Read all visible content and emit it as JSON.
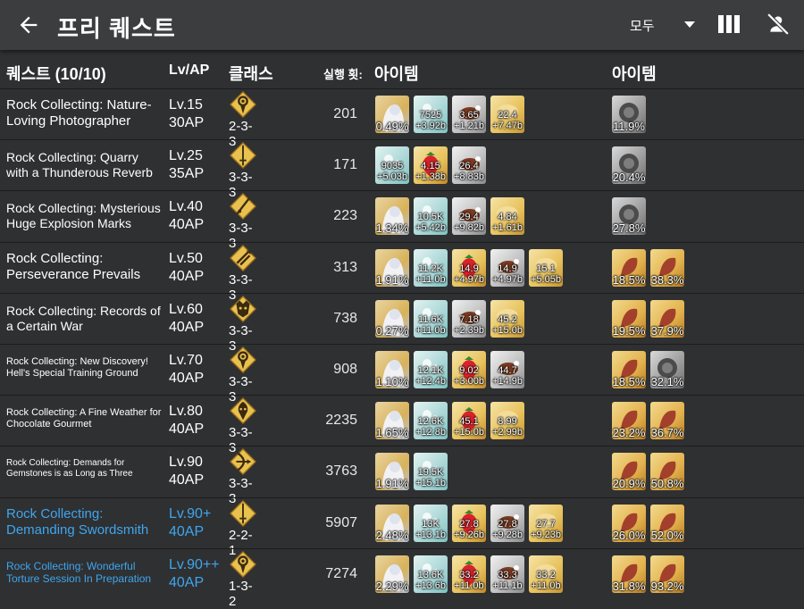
{
  "header": {
    "title": "프리 퀘스트",
    "filter": "모두"
  },
  "table_header": {
    "quests": "퀘스트 (10/10)",
    "lvap": "Lv/AP",
    "class": "클래스",
    "runs": "실행 횟:",
    "items1": "아이템",
    "items2": "아이템"
  },
  "colors": {
    "bg": "#2f3032",
    "appbar": "#3c3d3f",
    "link": "#3ea6ee",
    "gold": "#d8a33a"
  },
  "rows": [
    {
      "name": "Rock Collecting: Nature-Loving Photographer",
      "fs": 15,
      "blue": false,
      "lv": "Lv.15",
      "ap": "30AP",
      "cls": "2-3-3",
      "icon": "caster-class-icon",
      "runs": "201",
      "items": [
        {
          "kind": "ce",
          "a": "",
          "b": "",
          "pc": "0.49%"
        },
        {
          "kind": "teal",
          "a": "7525",
          "b": "+3.92b"
        },
        {
          "kind": "meat",
          "a": "3.65",
          "b": "+1.21b"
        },
        {
          "kind": "bread",
          "a": "22.4",
          "b": "+7.47b"
        }
      ],
      "mats": [
        {
          "kind": "gray",
          "pc": "11.9%"
        }
      ]
    },
    {
      "name": "Rock Collecting: Quarry with a Thunderous Reverb",
      "fs": 14,
      "blue": false,
      "lv": "Lv.25",
      "ap": "35AP",
      "cls": "3-3-3",
      "icon": "saber-class-icon",
      "runs": "171",
      "items": [
        {
          "kind": "teal",
          "a": "9035",
          "b": "+5.03b"
        },
        {
          "kind": "straw",
          "a": "4.15",
          "b": "+1.38b"
        },
        {
          "kind": "meat",
          "a": "26.4",
          "b": "+8.83b"
        }
      ],
      "mats": [
        {
          "kind": "gray",
          "pc": "20.4%"
        }
      ]
    },
    {
      "name": "Rock Collecting: Mysterious Huge Explosion Marks",
      "fs": 14,
      "blue": false,
      "lv": "Lv.40",
      "ap": "40AP",
      "cls": "3-3-3",
      "icon": "lancer-class-icon",
      "runs": "223",
      "items": [
        {
          "kind": "ce",
          "a": "",
          "b": "",
          "pc": "1.34%"
        },
        {
          "kind": "teal",
          "a": "10.5K",
          "b": "+5.42b"
        },
        {
          "kind": "meat",
          "a": "29.4",
          "b": "+9.82b"
        },
        {
          "kind": "bread",
          "a": "4.84",
          "b": "+1.61b"
        }
      ],
      "mats": [
        {
          "kind": "gray",
          "pc": "27.8%"
        }
      ]
    },
    {
      "name": "Rock Collecting: Perseverance Prevails",
      "fs": 15,
      "blue": false,
      "lv": "Lv.50",
      "ap": "40AP",
      "cls": "3-3-3",
      "icon": "rider-class-icon",
      "runs": "313",
      "items": [
        {
          "kind": "ce",
          "a": "",
          "b": "",
          "pc": "1.91%"
        },
        {
          "kind": "teal",
          "a": "11.2K",
          "b": "+11.0b"
        },
        {
          "kind": "straw",
          "a": "14.9",
          "b": "+4.97b"
        },
        {
          "kind": "meat",
          "a": "14.9",
          "b": "+4.97b"
        },
        {
          "kind": "bread",
          "a": "15.1",
          "b": "+5.05b"
        }
      ],
      "mats": [
        {
          "kind": "gold",
          "pc": "18.5%"
        },
        {
          "kind": "gold",
          "pc": "38.3%"
        }
      ]
    },
    {
      "name": "Rock Collecting: Records of a Certain War",
      "fs": 14,
      "blue": false,
      "lv": "Lv.60",
      "ap": "40AP",
      "cls": "3-3-3",
      "icon": "berserker-class-icon",
      "runs": "738",
      "items": [
        {
          "kind": "ce",
          "a": "",
          "b": "",
          "pc": "0.27%"
        },
        {
          "kind": "teal",
          "a": "11.6K",
          "b": "+11.0b"
        },
        {
          "kind": "meat",
          "a": "7.18",
          "b": "+2.39b"
        },
        {
          "kind": "bread",
          "a": "45.2",
          "b": "+15.0b"
        }
      ],
      "mats": [
        {
          "kind": "gold",
          "pc": "19.5%"
        },
        {
          "kind": "gold",
          "pc": "37.9%"
        }
      ]
    },
    {
      "name": "Rock Collecting: New Discovery! Hell's Special Training Ground",
      "fs": 11,
      "blue": false,
      "lv": "Lv.70",
      "ap": "40AP",
      "cls": "3-3-3",
      "icon": "caster-class-icon",
      "runs": "908",
      "items": [
        {
          "kind": "ce",
          "a": "",
          "b": "",
          "pc": "1.10%"
        },
        {
          "kind": "teal",
          "a": "12.1K",
          "b": "+12.4b"
        },
        {
          "kind": "straw",
          "a": "9.02",
          "b": "+3.00b"
        },
        {
          "kind": "meat",
          "a": "44.7",
          "b": "+14.9b"
        }
      ],
      "mats": [
        {
          "kind": "gold",
          "pc": "18.5%"
        },
        {
          "kind": "gray",
          "pc": "32.1%"
        }
      ]
    },
    {
      "name": "Rock Collecting: A Fine Weather for Chocolate Gourmet",
      "fs": 11,
      "blue": false,
      "lv": "Lv.80",
      "ap": "40AP",
      "cls": "3-3-3",
      "icon": "assassin-class-icon",
      "runs": "2235",
      "items": [
        {
          "kind": "ce",
          "a": "",
          "b": "",
          "pc": "1.65%"
        },
        {
          "kind": "teal",
          "a": "12.6K",
          "b": "+12.8b"
        },
        {
          "kind": "straw",
          "a": "45.1",
          "b": "+15.0b"
        },
        {
          "kind": "bread",
          "a": "8.99",
          "b": "+2.99b"
        }
      ],
      "mats": [
        {
          "kind": "gold",
          "pc": "23.2%"
        },
        {
          "kind": "gold",
          "pc": "36.7%"
        }
      ]
    },
    {
      "name": "Rock Collecting: Demands for Gemstones is as Long as Three",
      "fs": 10,
      "blue": false,
      "lv": "Lv.90",
      "ap": "40AP",
      "cls": "3-3-3",
      "icon": "archer-class-icon",
      "runs": "3763",
      "items": [
        {
          "kind": "ce",
          "a": "",
          "b": "",
          "pc": "1.91%"
        },
        {
          "kind": "teal",
          "a": "19.5K",
          "b": "+15.1b"
        }
      ],
      "mats": [
        {
          "kind": "gold",
          "pc": "20.9%"
        },
        {
          "kind": "gold",
          "pc": "50.8%"
        }
      ]
    },
    {
      "name": "Rock Collecting: Demanding Swordsmith",
      "fs": 15,
      "blue": true,
      "lv": "Lv.90+",
      "ap": "40AP",
      "cls": "2-2-1",
      "icon": "saber-class-icon",
      "runs": "5907",
      "items": [
        {
          "kind": "ce",
          "a": "",
          "b": "",
          "pc": "2.48%"
        },
        {
          "kind": "teal",
          "a": "13K",
          "b": "+13.1b"
        },
        {
          "kind": "straw",
          "a": "27.8",
          "b": "+9.26b"
        },
        {
          "kind": "meat",
          "a": "27.8",
          "b": "+9.28b"
        },
        {
          "kind": "bread",
          "a": "27.7",
          "b": "+9.23b"
        }
      ],
      "mats": [
        {
          "kind": "gold",
          "pc": "26.0%"
        },
        {
          "kind": "gold",
          "pc": "52.0%"
        }
      ]
    },
    {
      "name": "Rock Collecting: Wonderful Torture Session In Preparation",
      "fs": 12,
      "blue": true,
      "lv": "Lv.90++",
      "ap": "40AP",
      "cls": "1-3-2",
      "icon": "caster-class-icon",
      "runs": "7274",
      "items": [
        {
          "kind": "ce",
          "a": "",
          "b": "",
          "pc": "2.29%"
        },
        {
          "kind": "teal",
          "a": "13.6K",
          "b": "+13.6b"
        },
        {
          "kind": "straw",
          "a": "33.2",
          "b": "+11.0b"
        },
        {
          "kind": "meat",
          "a": "33.3",
          "b": "+11.1b"
        },
        {
          "kind": "bread",
          "a": "33.2",
          "b": "+11.0b"
        }
      ],
      "mats": [
        {
          "kind": "gold",
          "pc": "31.8%"
        },
        {
          "kind": "gold",
          "pc": "93.2%"
        }
      ]
    }
  ]
}
